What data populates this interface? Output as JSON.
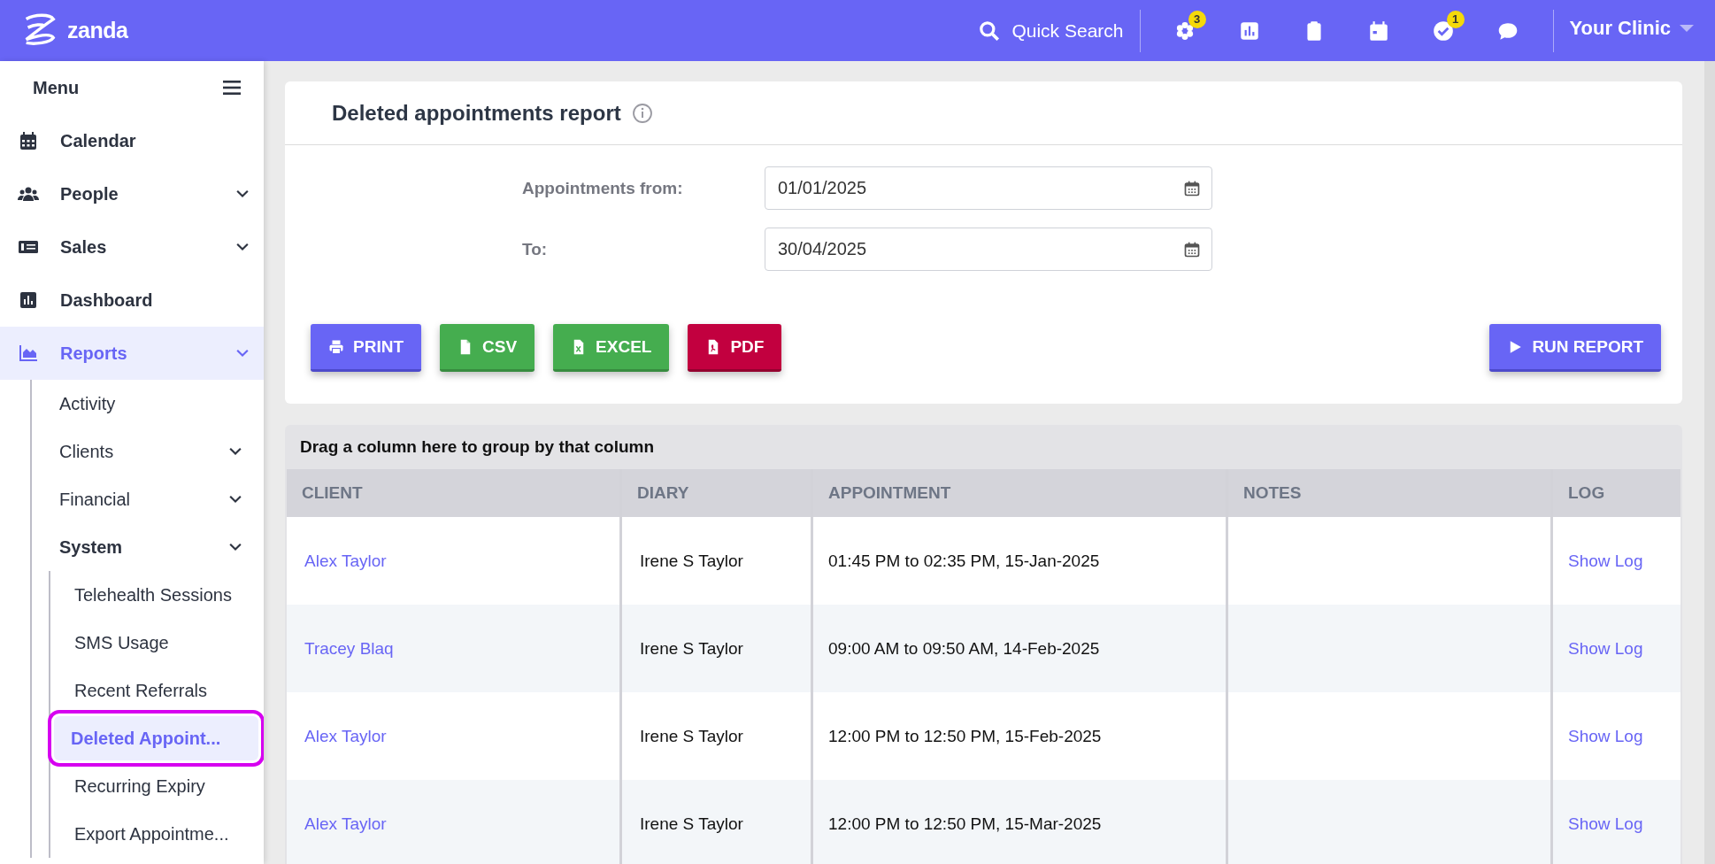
{
  "topbar": {
    "logo": "zanda",
    "search": "Quick Search",
    "icons": [
      {
        "kind": "flower",
        "badge": "3"
      },
      {
        "kind": "chart"
      },
      {
        "kind": "clipboard"
      },
      {
        "kind": "calendar"
      },
      {
        "kind": "check",
        "badge": "1"
      },
      {
        "kind": "chat"
      }
    ],
    "clinic": "Your Clinic"
  },
  "sidebar": {
    "title": "Menu",
    "items": [
      {
        "label": "Calendar",
        "kind": "calendar",
        "caret": false,
        "active": false
      },
      {
        "label": "People",
        "kind": "people",
        "caret": true,
        "active": false
      },
      {
        "label": "Sales",
        "kind": "sales",
        "caret": true,
        "active": false
      },
      {
        "label": "Dashboard",
        "kind": "chart",
        "caret": false,
        "active": false
      },
      {
        "label": "Reports",
        "kind": "area",
        "caret": true,
        "active": true,
        "children": [
          {
            "label": "Activity",
            "caret": false,
            "active": false
          },
          {
            "label": "Clients",
            "caret": true,
            "active": false
          },
          {
            "label": "Financial",
            "caret": true,
            "active": false
          },
          {
            "label": "System",
            "caret": true,
            "active": true,
            "children": [
              {
                "label": "Telehealth Sessions",
                "selected": false,
                "highlighted": false
              },
              {
                "label": "SMS Usage",
                "selected": false,
                "highlighted": false
              },
              {
                "label": "Recent Referrals",
                "selected": false,
                "highlighted": false
              },
              {
                "label": "Deleted Appoint...",
                "selected": true,
                "highlighted": true
              },
              {
                "label": "Recurring Expiry",
                "selected": false,
                "highlighted": false
              },
              {
                "label": "Export Appointme...",
                "selected": false,
                "highlighted": false
              }
            ]
          }
        ]
      }
    ]
  },
  "report": {
    "title": "Deleted appointments report",
    "fields": [
      {
        "label": "Appointments from:",
        "value": "01/01/2025"
      },
      {
        "label": "To:",
        "value": "30/04/2025"
      }
    ],
    "buttons": [
      {
        "kind": "print",
        "label": "PRINT"
      },
      {
        "kind": "csv",
        "label": "CSV"
      },
      {
        "kind": "excel",
        "label": "EXCEL"
      },
      {
        "kind": "pdf",
        "label": "PDF"
      },
      {
        "kind": "run",
        "label": "RUN REPORT"
      }
    ]
  },
  "grid": {
    "group_hint": "Drag a column here to group by that column",
    "columns": [
      "CLIENT",
      "DIARY",
      "APPOINTMENT",
      "NOTES",
      "LOG"
    ],
    "rows": [
      {
        "client": "Alex Taylor",
        "diary": "Irene S Taylor",
        "appointment": "01:45 PM to 02:35 PM, 15-Jan-2025",
        "log": "Show Log"
      },
      {
        "client": "Tracey Blaq",
        "diary": "Irene S Taylor",
        "appointment": "09:00 AM to 09:50 AM, 14-Feb-2025",
        "log": "Show Log"
      },
      {
        "client": "Alex Taylor",
        "diary": "Irene S Taylor",
        "appointment": "12:00 PM to 12:50 PM, 15-Feb-2025",
        "log": "Show Log"
      },
      {
        "client": "Alex Taylor",
        "diary": "Irene S Taylor",
        "appointment": "12:00 PM to 12:50 PM, 15-Mar-2025",
        "log": "Show Log"
      }
    ]
  }
}
